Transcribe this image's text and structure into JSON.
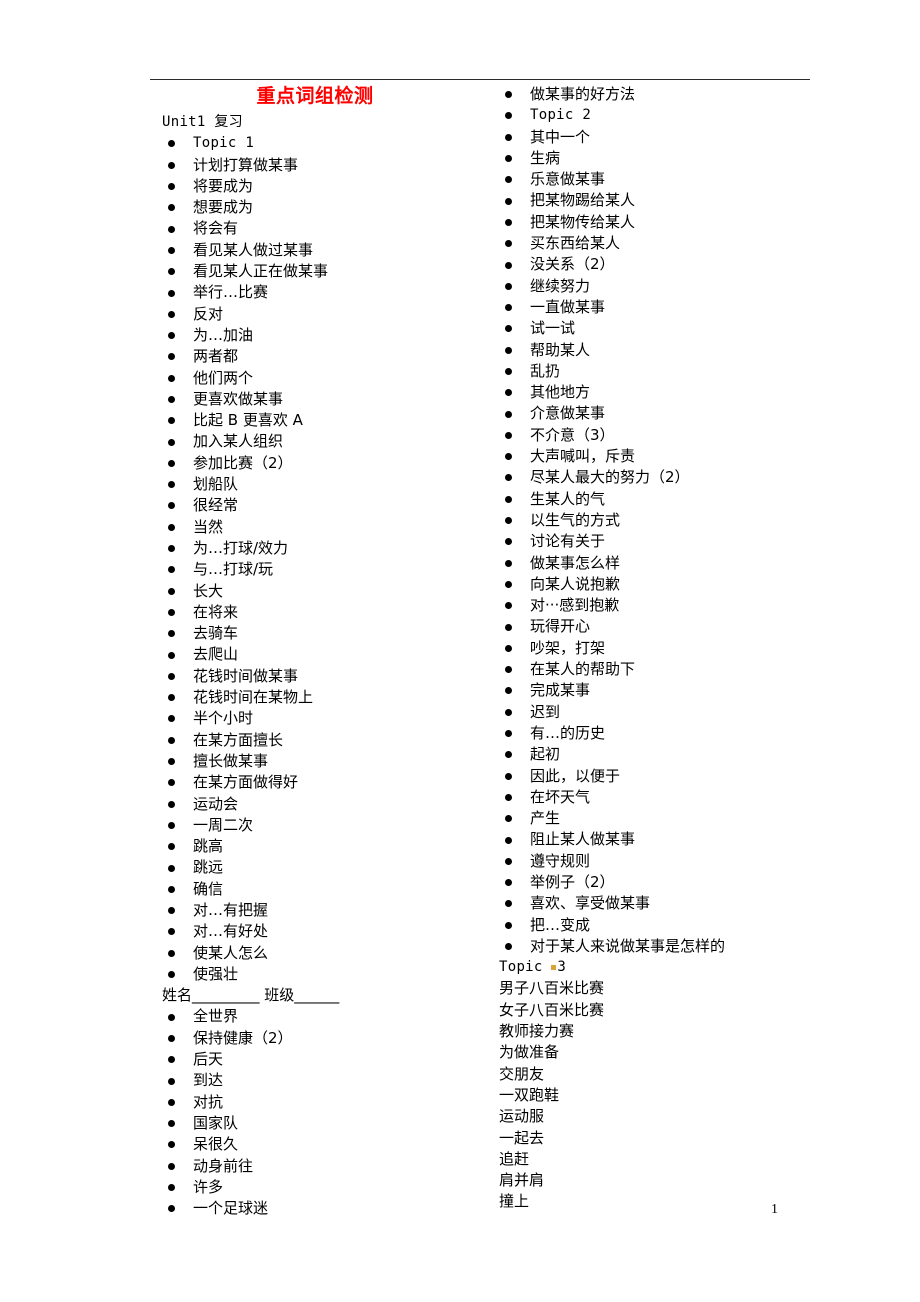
{
  "document": {
    "title": "重点词组检测",
    "title_color": "#ff0000",
    "page_number": "1"
  },
  "left_column": [
    {
      "type": "plain",
      "text": "Unit1 复习",
      "style": "mono"
    },
    {
      "type": "bulleted",
      "text": "Topic 1",
      "style": "mono"
    },
    {
      "type": "bulleted",
      "text": "计划打算做某事"
    },
    {
      "type": "bulleted",
      "text": "将要成为"
    },
    {
      "type": "bulleted",
      "text": "想要成为"
    },
    {
      "type": "bulleted",
      "text": "将会有"
    },
    {
      "type": "bulleted",
      "text": "看见某人做过某事"
    },
    {
      "type": "bulleted",
      "text": "看见某人正在做某事"
    },
    {
      "type": "bulleted",
      "text": "举行…比赛"
    },
    {
      "type": "bulleted",
      "text": "反对"
    },
    {
      "type": "bulleted",
      "text": "为…加油"
    },
    {
      "type": "bulleted",
      "text": "两者都"
    },
    {
      "type": "bulleted",
      "text": "他们两个"
    },
    {
      "type": "bulleted",
      "text": "更喜欢做某事"
    },
    {
      "type": "bulleted",
      "text": "比起 B 更喜欢 A"
    },
    {
      "type": "bulleted",
      "text": "加入某人组织"
    },
    {
      "type": "bulleted",
      "text": "参加比赛（2）"
    },
    {
      "type": "bulleted",
      "text": "划船队"
    },
    {
      "type": "bulleted",
      "text": "很经常"
    },
    {
      "type": "bulleted",
      "text": "当然"
    },
    {
      "type": "bulleted",
      "text": "为…打球/效力"
    },
    {
      "type": "bulleted",
      "text": "与…打球/玩"
    },
    {
      "type": "bulleted",
      "text": "长大"
    },
    {
      "type": "bulleted",
      "text": "在将来"
    },
    {
      "type": "bulleted",
      "text": "去骑车"
    },
    {
      "type": "bulleted",
      "text": "去爬山"
    },
    {
      "type": "bulleted",
      "text": "花钱时间做某事"
    },
    {
      "type": "bulleted",
      "text": "花钱时间在某物上"
    },
    {
      "type": "bulleted",
      "text": "半个小时"
    },
    {
      "type": "bulleted",
      "text": "在某方面擅长"
    },
    {
      "type": "bulleted",
      "text": "擅长做某事"
    },
    {
      "type": "bulleted",
      "text": "在某方面做得好"
    },
    {
      "type": "bulleted",
      "text": "运动会"
    },
    {
      "type": "bulleted",
      "text": "一周二次"
    },
    {
      "type": "bulleted",
      "text": "跳高"
    },
    {
      "type": "bulleted",
      "text": "跳远"
    },
    {
      "type": "bulleted",
      "text": "确信"
    },
    {
      "type": "bulleted",
      "text": "对…有把握"
    },
    {
      "type": "bulleted",
      "text": "对…有好处"
    },
    {
      "type": "bulleted",
      "text": "使某人怎么"
    },
    {
      "type": "bulleted",
      "text": "使强壮"
    },
    {
      "type": "fillin",
      "text": "姓名_________ 班级______"
    },
    {
      "type": "bulleted",
      "text": "全世界"
    },
    {
      "type": "bulleted",
      "text": "保持健康（2）"
    },
    {
      "type": "bulleted",
      "text": "后天"
    },
    {
      "type": "bulleted",
      "text": "到达"
    },
    {
      "type": "bulleted",
      "text": "对抗"
    },
    {
      "type": "bulleted",
      "text": "国家队"
    },
    {
      "type": "bulleted",
      "text": "呆很久"
    },
    {
      "type": "bulleted",
      "text": "动身前往"
    },
    {
      "type": "bulleted",
      "text": "许多"
    },
    {
      "type": "bulleted",
      "text": "一个足球迷"
    }
  ],
  "right_column": [
    {
      "type": "bulleted",
      "text": "做某事的好方法"
    },
    {
      "type": "bulleted",
      "text": "Topic 2",
      "style": "mono"
    },
    {
      "type": "bulleted",
      "text": "其中一个"
    },
    {
      "type": "bulleted",
      "text": "生病"
    },
    {
      "type": "bulleted",
      "text": "乐意做某事"
    },
    {
      "type": "bulleted",
      "text": "把某物踢给某人"
    },
    {
      "type": "bulleted",
      "text": "把某物传给某人"
    },
    {
      "type": "bulleted",
      "text": "买东西给某人"
    },
    {
      "type": "bulleted",
      "text": "没关系（2）"
    },
    {
      "type": "bulleted",
      "text": "继续努力"
    },
    {
      "type": "bulleted",
      "text": "一直做某事"
    },
    {
      "type": "bulleted",
      "text": "试一试"
    },
    {
      "type": "bulleted",
      "text": "帮助某人"
    },
    {
      "type": "bulleted",
      "text": "乱扔"
    },
    {
      "type": "bulleted",
      "text": "其他地方"
    },
    {
      "type": "bulleted",
      "text": "介意做某事"
    },
    {
      "type": "bulleted",
      "text": "不介意（3）"
    },
    {
      "type": "bulleted",
      "text": "大声喊叫，斥责"
    },
    {
      "type": "bulleted",
      "text": "尽某人最大的努力（2）"
    },
    {
      "type": "bulleted",
      "text": "生某人的气"
    },
    {
      "type": "bulleted",
      "text": "以生气的方式"
    },
    {
      "type": "bulleted",
      "text": "讨论有关于"
    },
    {
      "type": "bulleted",
      "text": "做某事怎么样"
    },
    {
      "type": "bulleted",
      "text": "向某人说抱歉"
    },
    {
      "type": "bulleted",
      "text": "对···感到抱歉"
    },
    {
      "type": "bulleted",
      "text": "玩得开心"
    },
    {
      "type": "bulleted",
      "text": "吵架，打架"
    },
    {
      "type": "bulleted",
      "text": "在某人的帮助下"
    },
    {
      "type": "bulleted",
      "text": "完成某事"
    },
    {
      "type": "bulleted",
      "text": "迟到"
    },
    {
      "type": "bulleted",
      "text": "有…的历史"
    },
    {
      "type": "bulleted",
      "text": "起初"
    },
    {
      "type": "bulleted",
      "text": "因此，以便于"
    },
    {
      "type": "bulleted",
      "text": "在坏天气"
    },
    {
      "type": "bulleted",
      "text": "产生"
    },
    {
      "type": "bulleted",
      "text": "阻止某人做某事"
    },
    {
      "type": "bulleted",
      "text": "遵守规则"
    },
    {
      "type": "bulleted",
      "text": "举例子（2）"
    },
    {
      "type": "bulleted",
      "text": "喜欢、享受做某事"
    },
    {
      "type": "bulleted",
      "text": "把…变成"
    },
    {
      "type": "bulleted",
      "text": "对于某人来说做某事是怎样的"
    },
    {
      "type": "plain",
      "text": "Topic 3",
      "style": "mono",
      "mark": true
    },
    {
      "type": "plain",
      "text": "男子八百米比赛"
    },
    {
      "type": "plain",
      "text": "女子八百米比赛"
    },
    {
      "type": "plain",
      "text": "教师接力赛"
    },
    {
      "type": "plain",
      "text": "为做准备"
    },
    {
      "type": "plain",
      "text": "交朋友"
    },
    {
      "type": "plain",
      "text": "一双跑鞋"
    },
    {
      "type": "plain",
      "text": "运动服"
    },
    {
      "type": "plain",
      "text": "一起去"
    },
    {
      "type": "plain",
      "text": "追赶"
    },
    {
      "type": "plain",
      "text": "肩并肩"
    },
    {
      "type": "plain",
      "text": "撞上"
    }
  ]
}
